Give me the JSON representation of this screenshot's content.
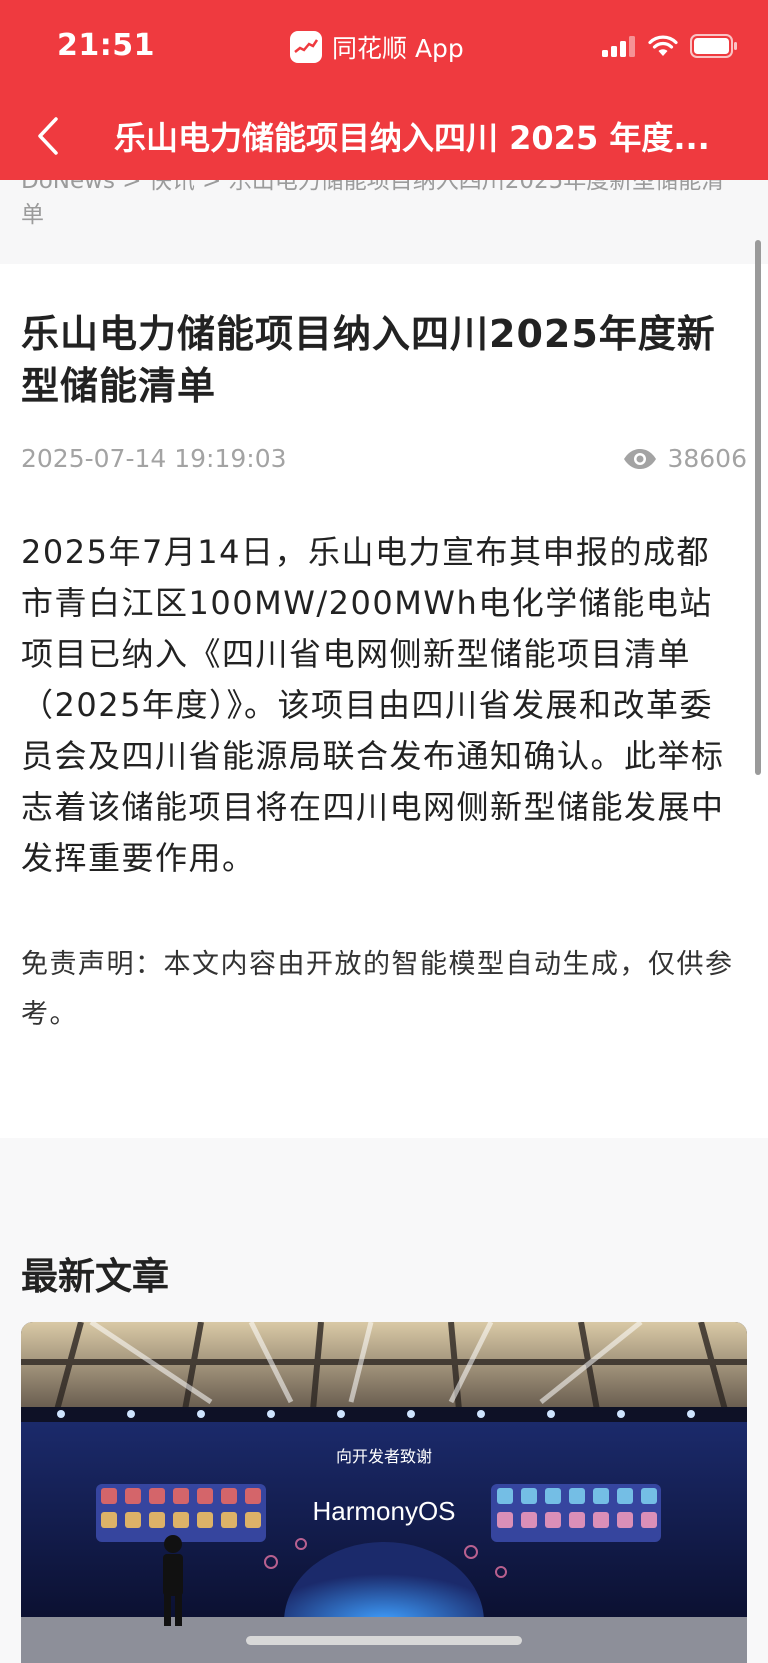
{
  "status_bar": {
    "time": "21:51",
    "app_name": "同花顺 App"
  },
  "nav": {
    "title": "乐山电力储能项目纳入四川 2025 年度..."
  },
  "breadcrumb": "DoNews > 快讯 > 乐山电力储能项目纳入四川2025年度新型储能清单",
  "article": {
    "title": "乐山电力储能项目纳入四川2025年度新型储能清单",
    "date": "2025-07-14 19:19:03",
    "views": "38606",
    "body": "2025年7月14日，乐山电力宣布其申报的成都市青白江区100MW/200MWh电化学储能电站项目已纳入《四川省电网侧新型储能项目清单（2025年度）》。该项目由四川省发展和改革委员会及四川省能源局联合发布通知确认。此举标志着该储能项目将在四川电网侧新型储能发展中发挥重要作用。",
    "disclaimer": "免责声明：本文内容由开放的智能模型自动生成，仅供参考。"
  },
  "latest": {
    "section_title": "最新文章",
    "card_banner": "向开发者致谢",
    "card_brand": "HarmonyOS"
  },
  "colors": {
    "brand_red": "#ef3a3f",
    "meta_gray": "#a3a3a3"
  },
  "icons": [
    "back-arrow-icon",
    "signal-icon",
    "wifi-icon",
    "battery-icon",
    "eye-icon",
    "app-logo-icon"
  ]
}
